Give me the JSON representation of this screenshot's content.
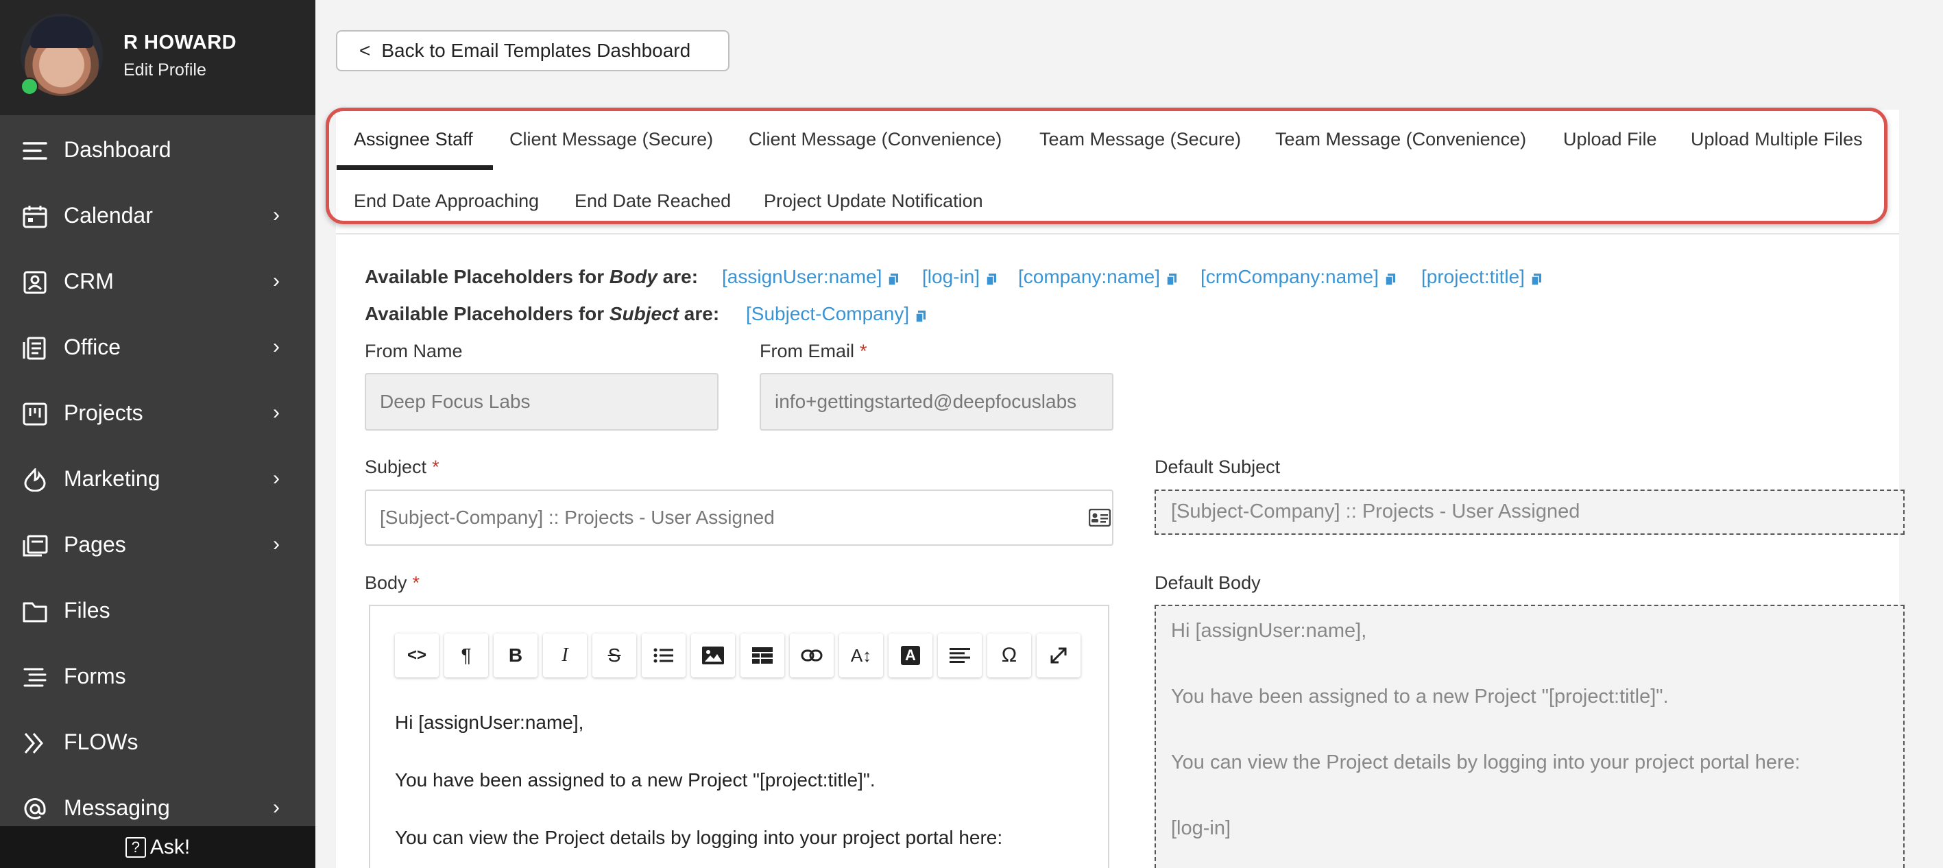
{
  "profile": {
    "name": "R HOWARD",
    "edit_label": "Edit Profile"
  },
  "nav": [
    {
      "label": "Dashboard",
      "icon": "menu-icon",
      "has_children": false
    },
    {
      "label": "Calendar",
      "icon": "calendar-icon",
      "has_children": true
    },
    {
      "label": "CRM",
      "icon": "contact-card-icon",
      "has_children": true
    },
    {
      "label": "Office",
      "icon": "office-document-icon",
      "has_children": true
    },
    {
      "label": "Projects",
      "icon": "kanban-board-icon",
      "has_children": true
    },
    {
      "label": "Marketing",
      "icon": "flame-icon",
      "has_children": true
    },
    {
      "label": "Pages",
      "icon": "pages-icon",
      "has_children": true
    },
    {
      "label": "Files",
      "icon": "folder-icon",
      "has_children": false
    },
    {
      "label": "Forms",
      "icon": "form-list-icon",
      "has_children": false
    },
    {
      "label": "FLOWs",
      "icon": "double-chevron-icon",
      "has_children": false
    },
    {
      "label": "Messaging",
      "icon": "at-sign-icon",
      "has_children": true
    }
  ],
  "ask": {
    "label": "Ask!",
    "icon": "question-box-icon"
  },
  "back_button": {
    "arrow": "<",
    "label": "Back to Email Templates Dashboard"
  },
  "tabs": [
    {
      "label": "Assignee Staff",
      "active": true
    },
    {
      "label": "Client Message (Secure)",
      "active": false
    },
    {
      "label": "Client Message (Convenience)",
      "active": false
    },
    {
      "label": "Team Message (Secure)",
      "active": false
    },
    {
      "label": "Team Message (Convenience)",
      "active": false
    },
    {
      "label": "Upload File",
      "active": false
    },
    {
      "label": "Upload Multiple Files",
      "active": false
    },
    {
      "label": "End Date Approaching",
      "active": false
    },
    {
      "label": "End Date Reached",
      "active": false
    },
    {
      "label": "Project Update Notification",
      "active": false
    }
  ],
  "placeholders": {
    "body_label_prefix": "Available Placeholders for ",
    "body_label_em": "Body",
    "body_label_suffix": " are:",
    "body_items": [
      "[assignUser:name]",
      "[log-in]",
      "[company:name]",
      "[crmCompany:name]",
      "[project:title]"
    ],
    "subject_label_prefix": "Available Placeholders for ",
    "subject_label_em": "Subject",
    "subject_label_suffix": " are:",
    "subject_items": [
      "[Subject-Company]"
    ]
  },
  "form": {
    "from_name_label": "From Name",
    "from_name_value": "Deep Focus Labs",
    "from_email_label": "From Email",
    "from_email_value": "info+gettingstarted@deepfocuslabs",
    "required_mark": "*",
    "subject_label": "Subject",
    "subject_value": "[Subject-Company] :: Projects - User Assigned",
    "default_subject_label": "Default Subject",
    "default_subject_value": "[Subject-Company] :: Projects - User Assigned",
    "body_label": "Body",
    "default_body_label": "Default Body",
    "body_lines": [
      "Hi [assignUser:name],",
      "You have been assigned to a new Project \"[project:title]\".",
      "You can view the Project details by logging into your project portal here:"
    ],
    "default_body_lines": [
      "Hi [assignUser:name],",
      "You have been assigned to a new Project \"[project:title]\".",
      "You can view the Project details by logging into your project portal here:",
      "[log-in]"
    ]
  },
  "toolbar": [
    {
      "name": "code-view-button",
      "glyph": "<>"
    },
    {
      "name": "paragraph-button",
      "glyph": "¶"
    },
    {
      "name": "bold-button",
      "glyph": "B"
    },
    {
      "name": "italic-button",
      "glyph": "I"
    },
    {
      "name": "strikethrough-button",
      "glyph": "S"
    },
    {
      "name": "list-button",
      "glyph": ""
    },
    {
      "name": "image-button",
      "glyph": ""
    },
    {
      "name": "table-button",
      "glyph": ""
    },
    {
      "name": "link-button",
      "glyph": ""
    },
    {
      "name": "font-size-button",
      "glyph": "A↕"
    },
    {
      "name": "text-color-button",
      "glyph": "A"
    },
    {
      "name": "align-button",
      "glyph": ""
    },
    {
      "name": "special-char-button",
      "glyph": "Ω"
    },
    {
      "name": "fullscreen-button",
      "glyph": ""
    }
  ],
  "colors": {
    "sidebar": "#3c3c3c",
    "profile": "#262626",
    "link": "#3a94d4",
    "highlight": "#d9534f",
    "required": "#c0392b"
  }
}
